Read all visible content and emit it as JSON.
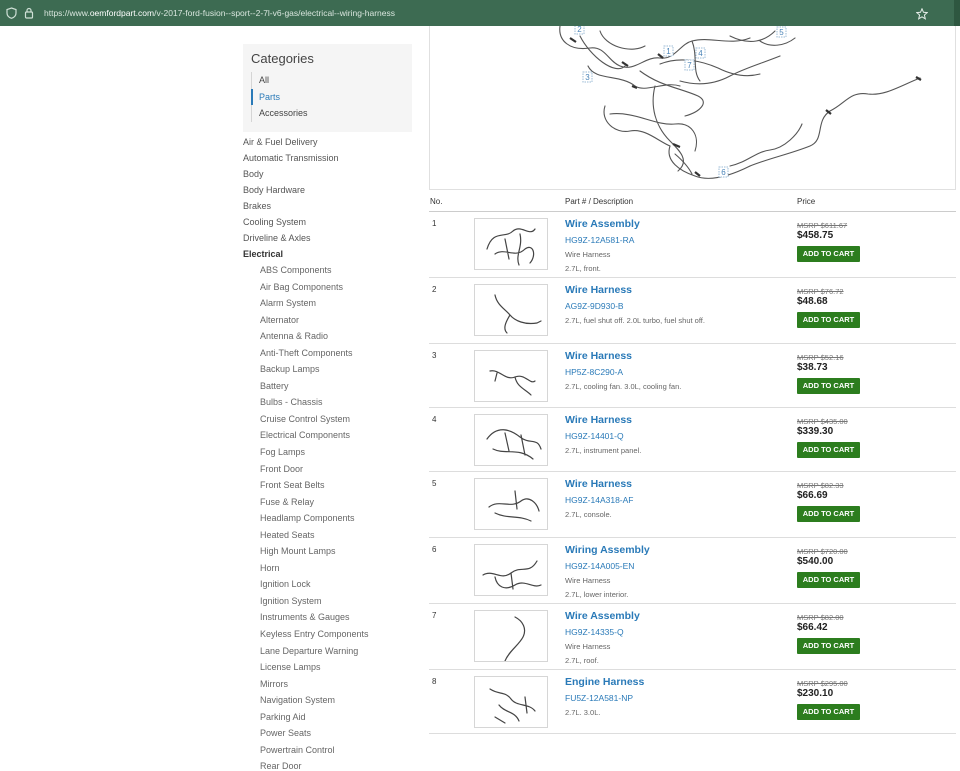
{
  "browser": {
    "url_prefix": "https://www.",
    "url_host": "oemfordpart.com",
    "url_path": "/v-2017-ford-fusion--sport--2-7l-v6-gas/electrical--wiring-harness"
  },
  "categories": {
    "title": "Categories",
    "options": [
      "All",
      "Parts",
      "Accessories"
    ],
    "active": "Parts"
  },
  "sidebar": {
    "top_items": [
      "Air & Fuel Delivery",
      "Automatic Transmission",
      "Body",
      "Body Hardware",
      "Brakes",
      "Cooling System",
      "Driveline & Axles"
    ],
    "expanded": "Electrical",
    "sub_items": [
      "ABS Components",
      "Air Bag Components",
      "Alarm System",
      "Alternator",
      "Antenna & Radio",
      "Anti-Theft Components",
      "Backup Lamps",
      "Battery",
      "Bulbs - Chassis",
      "Cruise Control System",
      "Electrical Components",
      "Fog Lamps",
      "Front Door",
      "Front Seat Belts",
      "Fuse & Relay",
      "Headlamp Components",
      "Heated Seats",
      "High Mount Lamps",
      "Horn",
      "Ignition Lock",
      "Ignition System",
      "Instruments & Gauges",
      "Keyless Entry Components",
      "Lane Departure Warning",
      "License Lamps",
      "Mirrors",
      "Navigation System",
      "Parking Aid",
      "Power Seats",
      "Powertrain Control",
      "Rear Door"
    ]
  },
  "diagram": {
    "callouts": [
      "1",
      "2",
      "3",
      "4",
      "5",
      "6",
      "7"
    ]
  },
  "table": {
    "headers": {
      "no": "No.",
      "part": "Part # / Description",
      "price": "Price"
    },
    "cart_label": "ADD TO CART",
    "rows": [
      {
        "no": "1",
        "name": "Wire Assembly",
        "pn": "HG9Z-12A581-RA",
        "lines": [
          "Wire Harness",
          "2.7L, front."
        ],
        "msrp": "MSRP $611.67",
        "price": "$458.75"
      },
      {
        "no": "2",
        "name": "Wire Harness",
        "pn": "AG9Z-9D930-B",
        "lines": [
          "2.7L, fuel shut off. 2.0L turbo, fuel shut off."
        ],
        "msrp": "MSRP $76.72",
        "price": "$48.68"
      },
      {
        "no": "3",
        "name": "Wire Harness",
        "pn": "HP5Z-8C290-A",
        "lines": [
          "2.7L, cooling fan. 3.0L, cooling fan."
        ],
        "msrp": "MSRP $52.16",
        "price": "$38.73"
      },
      {
        "no": "4",
        "name": "Wire Harness",
        "pn": "HG9Z-14401-Q",
        "lines": [
          "2.7L, instrument panel."
        ],
        "msrp": "MSRP $435.00",
        "price": "$339.30"
      },
      {
        "no": "5",
        "name": "Wire Harness",
        "pn": "HG9Z-14A318-AF",
        "lines": [
          "2.7L, console."
        ],
        "msrp": "MSRP $82.33",
        "price": "$66.69"
      },
      {
        "no": "6",
        "name": "Wiring Assembly",
        "pn": "HG9Z-14A005-EN",
        "lines": [
          "Wire Harness",
          "2.7L, lower interior."
        ],
        "msrp": "MSRP $720.00",
        "price": "$540.00"
      },
      {
        "no": "7",
        "name": "Wire Assembly",
        "pn": "HG9Z-14335-Q",
        "lines": [
          "Wire Harness",
          "2.7L, roof."
        ],
        "msrp": "MSRP $82.00",
        "price": "$66.42"
      },
      {
        "no": "8",
        "name": "Engine Harness",
        "pn": "FU5Z-12A581-NP",
        "lines": [
          "2.7L. 3.0L."
        ],
        "msrp": "MSRP $295.00",
        "price": "$230.10"
      }
    ]
  }
}
